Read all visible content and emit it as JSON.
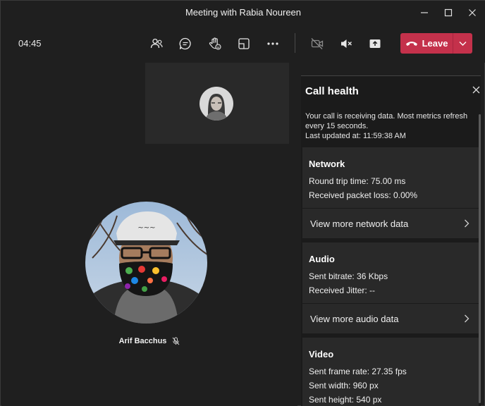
{
  "window": {
    "title": "Meeting with Rabia Noureen"
  },
  "toolbar": {
    "timer": "04:45",
    "leave_label": "Leave"
  },
  "participants": {
    "main_name": "Arif Bacchus"
  },
  "panel": {
    "title": "Call health",
    "description": "Your call is receiving data. Most metrics refresh every 15 seconds.",
    "last_updated": "Last updated at: 11:59:38 AM",
    "network": {
      "heading": "Network",
      "rtt": "Round trip time: 75.00 ms",
      "loss": "Received packet loss: 0.00%",
      "more": "View more network data"
    },
    "audio": {
      "heading": "Audio",
      "bitrate": "Sent bitrate: 36 Kbps",
      "jitter": "Received Jitter: --",
      "more": "View more audio data"
    },
    "video": {
      "heading": "Video",
      "frame_rate": "Sent frame rate: 27.35 fps",
      "width": "Sent width: 960 px",
      "height": "Sent height: 540 px"
    }
  },
  "colors": {
    "leave": "#c4314b",
    "background": "#1f1f1f",
    "card": "#292929"
  }
}
